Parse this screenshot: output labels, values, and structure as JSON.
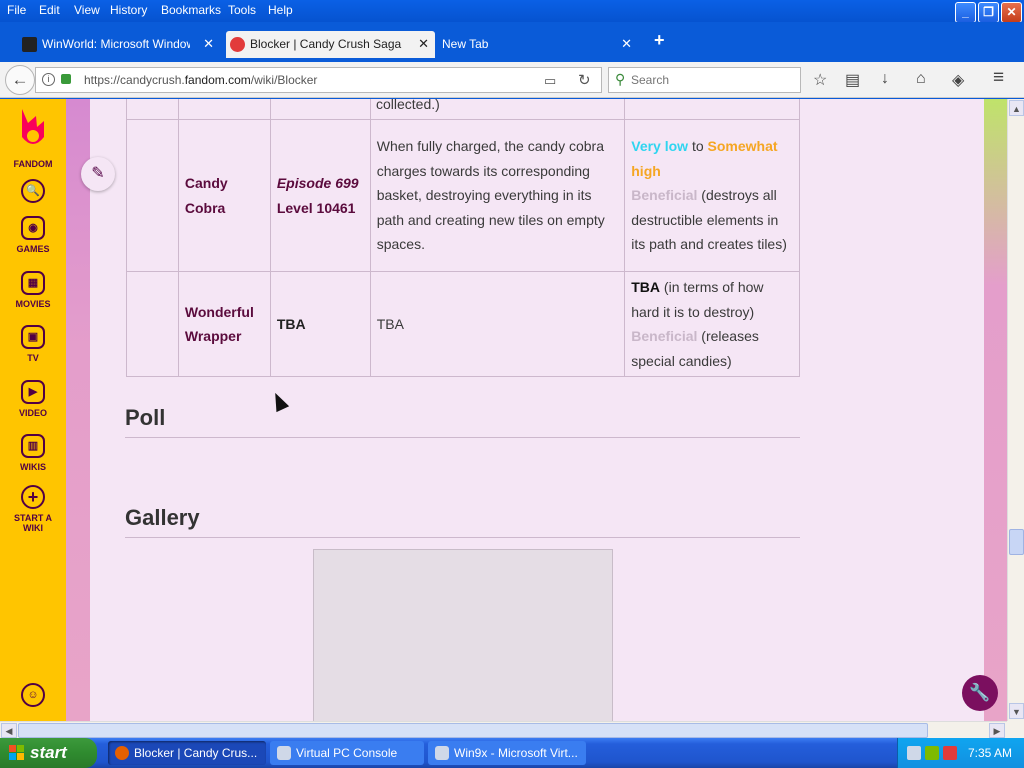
{
  "menubar": {
    "items": [
      "File",
      "Edit",
      "View",
      "History",
      "Bookmarks",
      "Tools",
      "Help"
    ],
    "minimize": "_",
    "restore": "❐",
    "close": "✕"
  },
  "tabs": [
    {
      "title": "WinWorld: Microsoft Windows...",
      "close": "✕"
    },
    {
      "title": "Blocker | Candy Crush Saga ...",
      "close": "✕"
    },
    {
      "title": "New Tab",
      "close": "✕"
    }
  ],
  "newtab": "+",
  "nav": {
    "back": "←",
    "url_prefix": "https://candycrush.",
    "url_domain": "fandom.com",
    "url_path": "/wiki/Blocker",
    "reader": "▭",
    "reload": "↻",
    "search_placeholder": "Search"
  },
  "toolbar_icons": [
    "☆",
    "▤",
    "↓",
    "⌂",
    "◈",
    "≡"
  ],
  "rail": [
    {
      "label": "FANDOM"
    },
    {
      "label": "",
      "icon": "🔍"
    },
    {
      "label": "GAMES",
      "icon": "◉"
    },
    {
      "label": "MOVIES",
      "icon": "▦"
    },
    {
      "label": "TV",
      "icon": "▣"
    },
    {
      "label": "VIDEO",
      "icon": "▶"
    },
    {
      "label": "WIKIS",
      "icon": "▥"
    },
    {
      "label": "START A",
      "label2": "WIKI",
      "icon": "+"
    },
    {
      "label": "",
      "icon": "☺"
    }
  ],
  "table": {
    "top_fragment": "collected.)",
    "rows": [
      {
        "name_1": "Candy",
        "name_2": "Cobra",
        "episode": "Episode 699",
        "level": "Level 10461",
        "desc": "When fully charged, the candy cobra charges towards its corresponding basket, destroying everything in its path and creating new tiles on empty spaces.",
        "diff_a": "Very low",
        "diff_to": "to",
        "diff_b": "Somewhat high",
        "benef": "Beneficial",
        "benef_note": "(destroys all destructible elements in its path and creates tiles)"
      },
      {
        "name_1": "Wonderful",
        "name_2": "Wrapper",
        "episode": "TBA",
        "desc": "TBA",
        "tba": "TBA",
        "tba_note": "(in terms of how hard it is to destroy)",
        "benef": "Beneficial",
        "benef_note": "(releases special candies)"
      }
    ]
  },
  "sections": {
    "poll": "Poll",
    "gallery": "Gallery"
  },
  "taskbar": {
    "start": "start",
    "buttons": [
      "Blocker | Candy Crus...",
      "Virtual PC Console",
      "Win9x - Microsoft Virt..."
    ],
    "clock": "7:35 AM"
  },
  "colors": {
    "fandom_yellow": "#ffc500",
    "fandom_purple": "#520044",
    "very_low": "#2fd5f0",
    "somewhat_high": "#f5a623"
  }
}
